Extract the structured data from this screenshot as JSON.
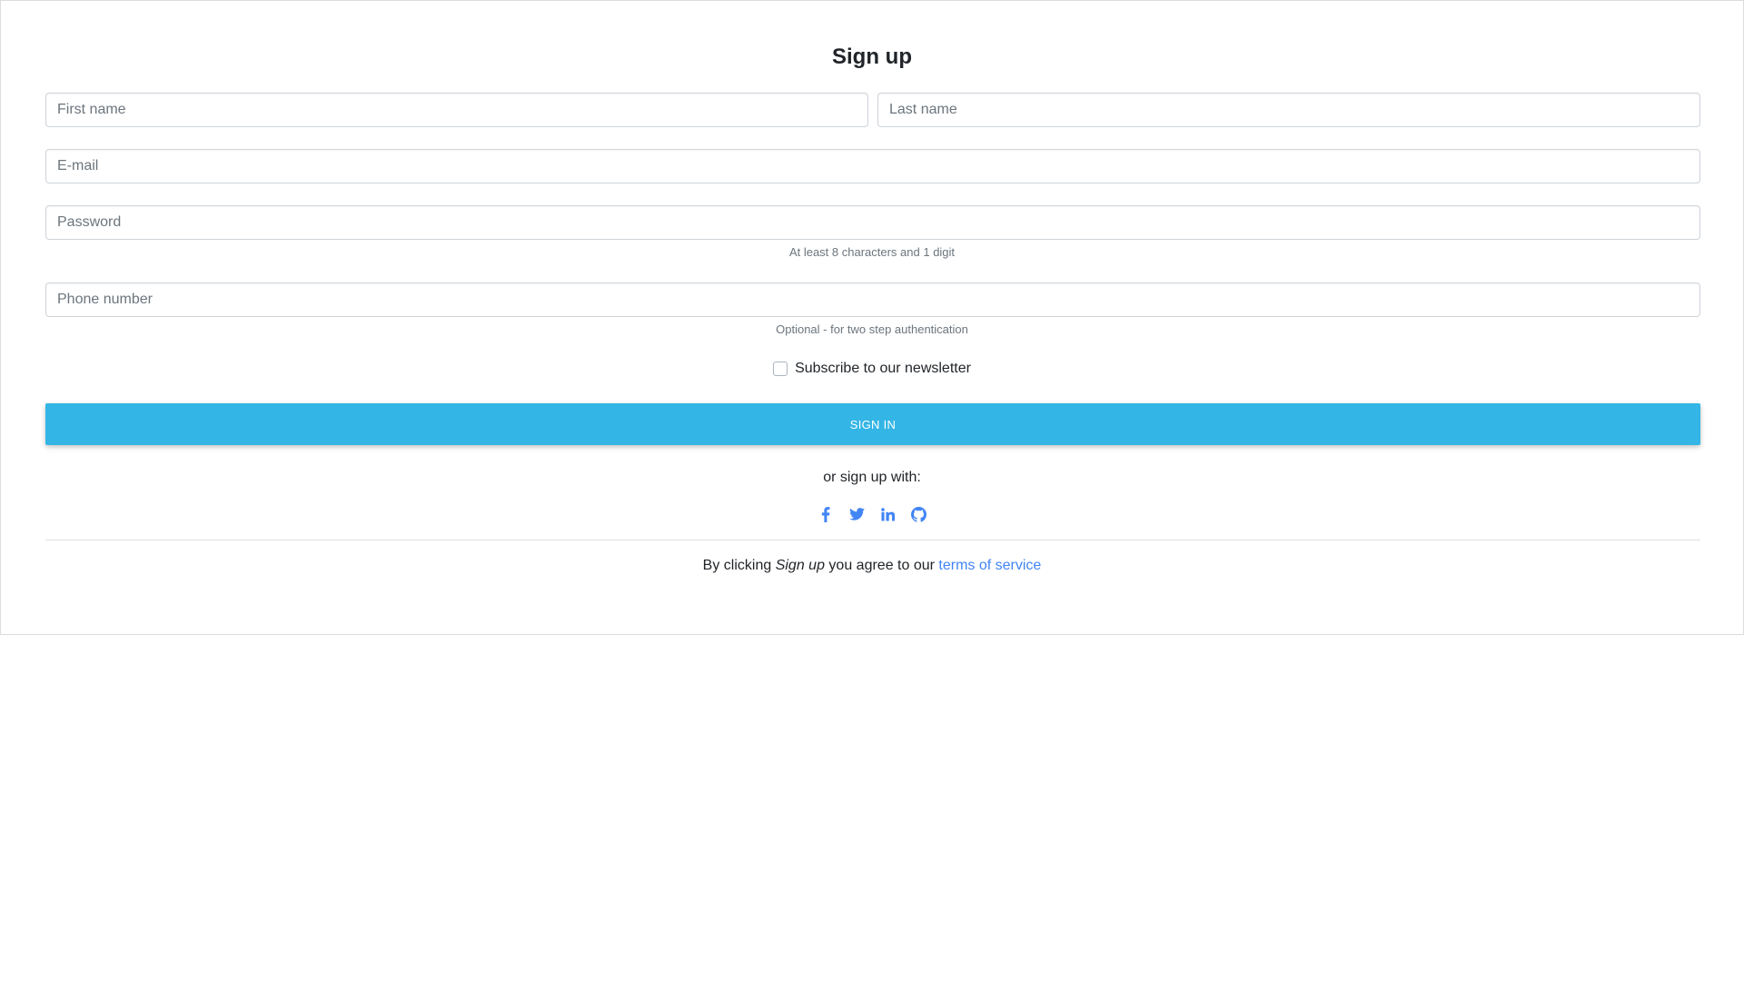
{
  "form": {
    "title": "Sign up",
    "first_name_placeholder": "First name",
    "last_name_placeholder": "Last name",
    "email_placeholder": "E-mail",
    "password_placeholder": "Password",
    "password_hint": "At least 8 characters and 1 digit",
    "phone_placeholder": "Phone number",
    "phone_hint": "Optional - for two step authentication",
    "newsletter_label": "Subscribe to our newsletter",
    "submit_label": "Sign in"
  },
  "social": {
    "label": "or sign up with:",
    "icon_color": "#4285f4",
    "icons": [
      "facebook-icon",
      "twitter-icon",
      "linkedin-icon",
      "github-icon"
    ]
  },
  "terms": {
    "prefix": "By clicking",
    "emphasis": "Sign up",
    "middle": "you agree to our",
    "link_text": "terms of service",
    "link_color": "#4285f4"
  },
  "colors": {
    "primary_button": "#33b5e5",
    "primary_button_text": "#ffffff"
  }
}
